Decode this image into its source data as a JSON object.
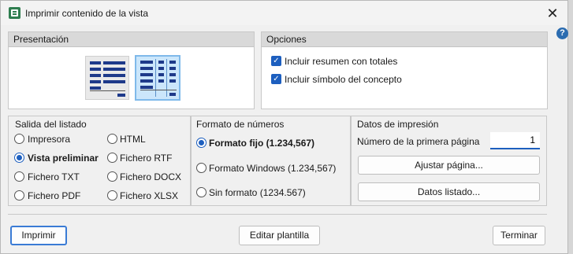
{
  "window": {
    "title": "Imprimir contenido de la vista",
    "app_icon": "spreadsheet-icon",
    "close_glyph": "✕"
  },
  "help": {
    "glyph": "?"
  },
  "presentation": {
    "title": "Presentación",
    "layouts": [
      {
        "name": "list-layout",
        "selected": false
      },
      {
        "name": "table-layout",
        "selected": true
      }
    ]
  },
  "options": {
    "title": "Opciones",
    "items": [
      {
        "label": "Incluir resumen con totales",
        "checked": true
      },
      {
        "label": "Incluir símbolo del concepto",
        "checked": true
      }
    ]
  },
  "output": {
    "title": "Salida del listado",
    "options": [
      {
        "label": "Impresora",
        "selected": false
      },
      {
        "label": "HTML",
        "selected": false
      },
      {
        "label": "Vista preliminar",
        "selected": true
      },
      {
        "label": "Fichero RTF",
        "selected": false
      },
      {
        "label": "Fichero TXT",
        "selected": false
      },
      {
        "label": "Fichero DOCX",
        "selected": false
      },
      {
        "label": "Fichero PDF",
        "selected": false
      },
      {
        "label": "Fichero XLSX",
        "selected": false
      }
    ]
  },
  "number_format": {
    "title": "Formato de números",
    "options": [
      {
        "label": "Formato fijo (1.234,567)",
        "selected": true
      },
      {
        "label": "Formato Windows (1.234,567)",
        "selected": false
      },
      {
        "label": "Sin formato (1234.567)",
        "selected": false
      }
    ]
  },
  "print_data": {
    "title": "Datos de impresión",
    "first_page_label": "Número de la primera página",
    "first_page_value": "1",
    "adjust_button": "Ajustar página...",
    "listing_button": "Datos listado..."
  },
  "footer": {
    "print_button": "Imprimir",
    "edit_template_button": "Editar plantilla",
    "finish_button": "Terminar"
  },
  "colors": {
    "accent": "#1d5fbf",
    "selected_layout_bg": "#cbe6fb",
    "layout_bar": "#1e3a8a"
  }
}
